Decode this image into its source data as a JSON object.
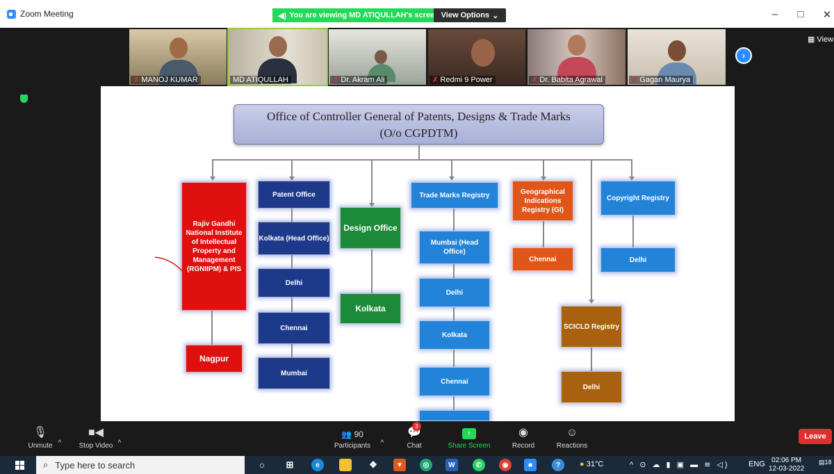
{
  "window": {
    "title": "Zoom Meeting"
  },
  "share_banner": {
    "text": "You are viewing MD ATIQULLAH's screen"
  },
  "view_options": {
    "label": "View Options"
  },
  "view_label": "View",
  "participants": [
    {
      "name": "MANOJ KUMAR",
      "muted": true
    },
    {
      "name": "MD ATIQULLAH",
      "muted": false
    },
    {
      "name": "Dr. Akram Ali",
      "muted": true
    },
    {
      "name": "Redmi 9 Power",
      "muted": true
    },
    {
      "name": "Dr. Babita Agrawal",
      "muted": true
    },
    {
      "name": "Gagan Maurya",
      "muted": true
    }
  ],
  "slide": {
    "title_line1": "Office of Controller General of Patents, Designs & Trade Marks",
    "title_line2": "(O/o CGPDTM)",
    "boxes": {
      "rgniipm": "Rajiv Gandhi National Institute of Intellectual Property and Management (RGNIIPM) & PIS",
      "nagpur": "Nagpur",
      "patent_office": "Patent Office",
      "patent_kolkata": "Kolkata (Head Office)",
      "patent_delhi": "Delhi",
      "patent_chennai": "Chennai",
      "patent_mumbai": "Mumbai",
      "design_office": "Design Office",
      "design_kolkata": "Kolkata",
      "tm_registry": "Trade Marks Registry",
      "tm_mumbai": "Mumbai (Head Office)",
      "tm_delhi": "Delhi",
      "tm_kolkata": "Kolkata",
      "tm_chennai": "Chennai",
      "gi_registry": "Geographical Indications Registry (GI)",
      "gi_chennai": "Chennai",
      "copyright_registry": "Copyright Registry",
      "copyright_delhi": "Delhi",
      "sciclid_registry": "SCICLD Registry",
      "sciclid_delhi": "Delhi"
    }
  },
  "toolbar": {
    "unmute": "Unmute",
    "stop_video": "Stop Video",
    "participants_label": "Participants",
    "participants_count": "90",
    "chat": "Chat",
    "chat_badge": "3",
    "share_screen": "Share Screen",
    "record": "Record",
    "reactions": "Reactions",
    "leave": "Leave"
  },
  "taskbar": {
    "search_placeholder": "Type here to search",
    "weather": "31°C",
    "language": "ENG",
    "time": "02:06 PM",
    "date": "12-03-2022",
    "notification_count": "18"
  },
  "colors": {
    "zoom_blue": "#2d8cff",
    "share_green": "#23d959",
    "leave_red": "#e0302e"
  }
}
